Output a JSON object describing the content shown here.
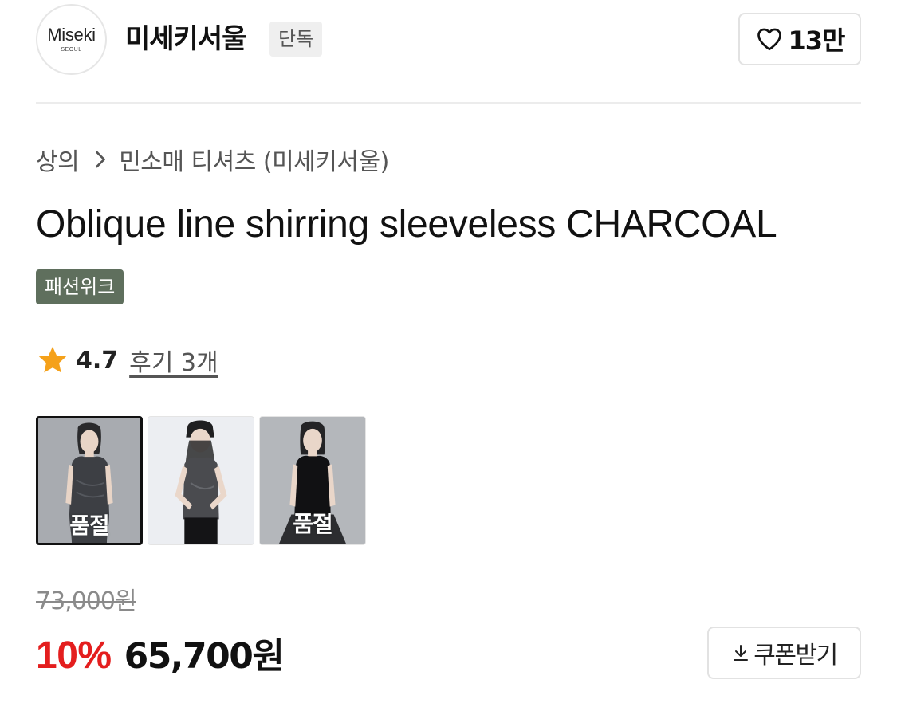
{
  "brand": {
    "logo_text": "Miseki",
    "logo_subtext": "SEOUL",
    "name": "미세키서울",
    "badge": "단독",
    "likes": "13만",
    "heart_icon": "heart-outline-icon"
  },
  "breadcrumb": {
    "category": "상의",
    "separator_icon": "chevron-right-icon",
    "subcategory": "민소매 티셔츠 (미세키서울)"
  },
  "product": {
    "title": "Oblique line shirring sleeveless CHARCOAL",
    "event_badge": "패션위크",
    "event_badge_color": "#5f6f5d"
  },
  "rating": {
    "star_icon": "star-icon",
    "star_color": "#f5a11a",
    "value": "4.7",
    "reviews_label": "후기 3개"
  },
  "thumbnails": [
    {
      "label": "품절",
      "selected": true,
      "sold_out": true
    },
    {
      "label": "",
      "selected": false,
      "sold_out": false
    },
    {
      "label": "품절",
      "selected": false,
      "sold_out": true
    }
  ],
  "price": {
    "original": "73,000원",
    "discount_rate": "10%",
    "sale": "65,700원",
    "discount_color": "#e41e1e"
  },
  "coupon": {
    "icon": "download-icon",
    "label": "쿠폰받기"
  }
}
